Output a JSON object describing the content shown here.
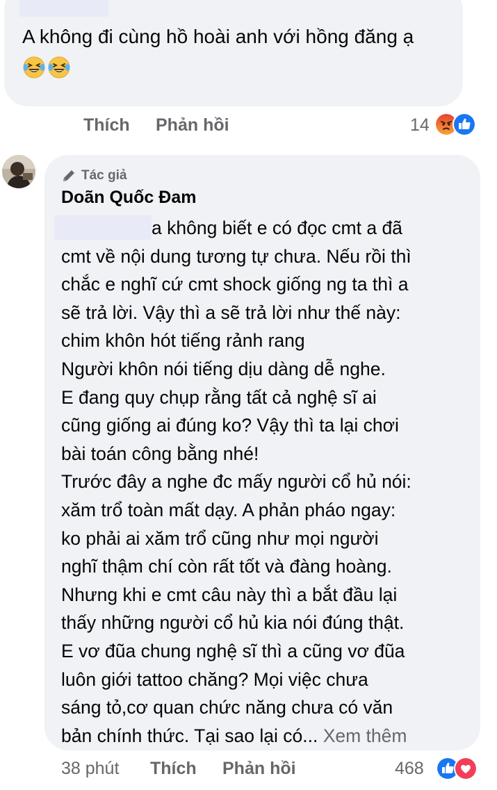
{
  "comment1": {
    "text": "A không đi cùng hồ hoài anh với hồng đăng ạ",
    "emojis": [
      "laughing-tears",
      "laughing-tears"
    ],
    "actions": {
      "like": "Thích",
      "reply": "Phản hồi"
    },
    "reaction_count": "14",
    "reaction_icons": [
      "angry",
      "like"
    ]
  },
  "comment2": {
    "author_badge": "Tác giả",
    "author_name": "Doãn Quốc Đam",
    "lines": [
      "a không biết e có đọc cmt a đã",
      "cmt về nội dung tương tự chưa. Nếu rồi thì",
      "chắc e nghĩ cứ cmt shock giống ng ta thì a",
      "sẽ trả lời. Vậy thì a sẽ trả lời như thế này:",
      "chim khôn hót tiếng rảnh rang",
      "Người khôn nói tiếng dịu dàng dễ nghe.",
      "E đang quy chụp rằng tất cả nghệ sĩ ai",
      "cũng giống ai đúng ko? Vậy thì ta lại chơi",
      "bài toán công bằng nhé!",
      "Trước đây a nghe đc mấy người cổ hủ nói:",
      "xăm trổ toàn mất dạy. A phản pháo ngay:",
      "ko phải ai xăm trổ cũng như mọi người",
      "nghĩ thậm chí còn rất tốt và đàng hoàng.",
      "Nhưng khi e cmt câu này thì a bắt đầu lại",
      "thấy những người cổ hủ kia nói đúng thật.",
      "E vơ đũa chung nghệ sĩ thì a cũng vơ đũa",
      "luôn giới tattoo chăng? Mọi việc chưa",
      "sáng tỏ,cơ quan chức năng chưa có văn",
      "bản chính thức. Tại sao lại có..."
    ],
    "see_more": "Xem thêm",
    "time": "38 phút",
    "actions": {
      "like": "Thích",
      "reply": "Phản hồi"
    },
    "reaction_count": "468",
    "reaction_icons": [
      "like",
      "love"
    ]
  },
  "colors": {
    "bubble": "#f0f2f5",
    "text": "#050505",
    "secondary": "#65676b",
    "like_blue": "#1877f2",
    "love_red": "#f33e58",
    "angry_orange": "#f07b2a"
  }
}
